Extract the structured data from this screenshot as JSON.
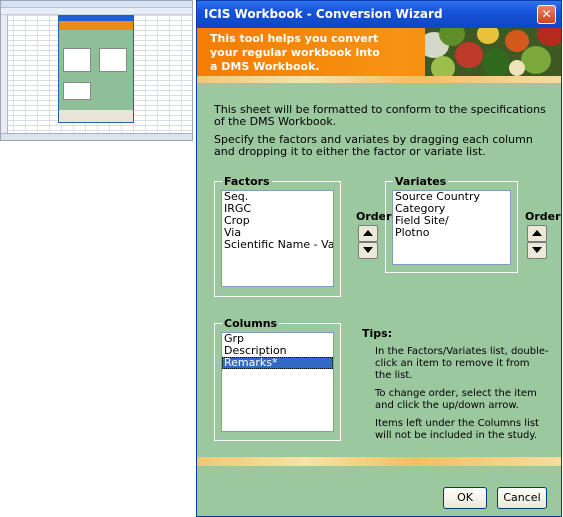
{
  "dialog": {
    "title": "ICIS Workbook - Conversion Wizard",
    "close_glyph": "✕",
    "banner_text": "This tool helps you convert your regular workbook into a DMS Workbook.",
    "intro_1": "This sheet will be formatted to conform to the specifications of the DMS Workbook.",
    "intro_2": "Specify the factors and variates by dragging each column and dropping it to either the factor or variate list."
  },
  "factors": {
    "label": "Factors",
    "items": [
      "Seq.",
      "IRGC",
      "Crop",
      "Via",
      "Scientific Name - Variety"
    ]
  },
  "variates": {
    "label": "Variates",
    "items": [
      "Source Country",
      "Category",
      "Field Site/",
      "Plotno"
    ]
  },
  "columns": {
    "label": "Columns",
    "items": [
      "Grp",
      "Description",
      "Remarks*"
    ],
    "selected_index": 2
  },
  "order_label": "Order",
  "tips": {
    "title": "Tips:",
    "items": [
      "In the Factors/Variates list, double-click an item to remove it from the list.",
      "To change order, select the item and click the up/down arrow.",
      "Items left under the Columns list will not be included in the study."
    ]
  },
  "buttons": {
    "ok": "OK",
    "cancel": "Cancel"
  },
  "colors": {
    "title_blue": "#1653d8",
    "banner_orange": "#f57d00",
    "dialog_green": "#9cc89f",
    "selection_blue": "#316ac5"
  }
}
